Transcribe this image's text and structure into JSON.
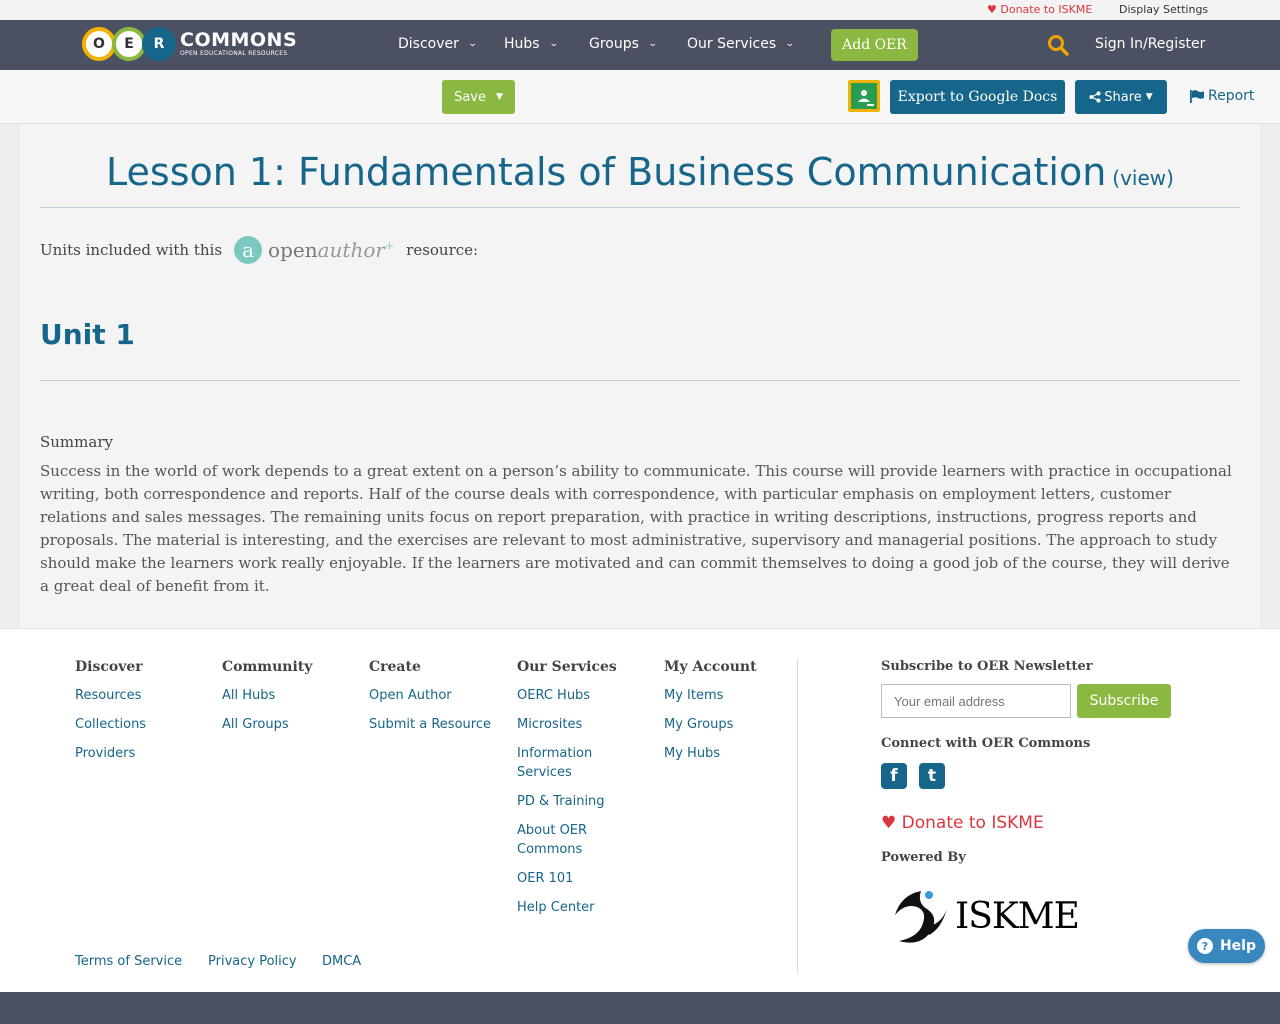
{
  "util": {
    "donate": "Donate to ISKME",
    "display_settings": "Display Settings"
  },
  "nav": {
    "logo_big": "COMMONS",
    "logo_small": "OPEN EDUCATIONAL RESOURCES",
    "logo_letters": [
      "O",
      "E",
      "R"
    ],
    "items": [
      {
        "label": "Discover"
      },
      {
        "label": "Hubs"
      },
      {
        "label": "Groups"
      },
      {
        "label": "Our Services"
      }
    ],
    "add_oer": "Add OER",
    "sign_in": "Sign In/Register"
  },
  "toolbar": {
    "save": "Save",
    "export": "Export to Google Docs",
    "share": "Share",
    "report": "Report"
  },
  "content": {
    "title": "Lesson 1: Fundamentals of Business Communication",
    "view_link": "(view)",
    "units_prefix": "Units included with this",
    "units_suffix": "resource:",
    "openauthor_a": "a",
    "openauthor_open": "open",
    "openauthor_author": "author",
    "openauthor_plus": "+",
    "unit_heading": "Unit 1",
    "summary_label": "Summary",
    "summary_text": "Success in the world of work depends to a great extent on a person’s ability to communicate. This course will provide learners with practice in occupational writing, both correspondence and reports. Half of the course deals with correspondence, with particular emphasis on employment letters, customer relations and sales messages. The remaining units focus on report preparation, with practice in writing descriptions, instructions, progress reports and proposals. The material is interesting, and the exercises are relevant to most administrative, supervisory and managerial positions. The approach to study should make the learners work really enjoyable. If the learners are motivated and can commit themselves to doing a good job of the course, they will derive a great deal of benefit from it."
  },
  "footer": {
    "discover": {
      "heading": "Discover",
      "links": [
        "Resources",
        "Collections",
        "Providers"
      ]
    },
    "community": {
      "heading": "Community",
      "links": [
        "All Hubs",
        "All Groups"
      ]
    },
    "create": {
      "heading": "Create",
      "links": [
        "Open Author",
        "Submit a Resource"
      ]
    },
    "services": {
      "heading": "Our Services",
      "links": [
        "OERC Hubs",
        "Microsites",
        "Information Services",
        "PD & Training",
        "About OER Commons",
        "OER 101",
        "Help Center"
      ]
    },
    "account": {
      "heading": "My Account",
      "links": [
        "My Items",
        "My Groups",
        "My Hubs"
      ]
    },
    "newsletter_heading": "Subscribe to OER Newsletter",
    "email_placeholder": "Your email address",
    "subscribe": "Subscribe",
    "connect_heading": "Connect with OER Commons",
    "facebook_glyph": "f",
    "twitter_glyph": "t",
    "donate": "Donate to ISKME",
    "powered_by": "Powered By",
    "iskme_logo_text": "ISKME",
    "legal": [
      "Terms of Service",
      "Privacy Policy",
      "DMCA"
    ]
  },
  "help_button": "Help",
  "colors": {
    "nav_bg": "#4b5162",
    "brand_blue": "#16658a",
    "brand_green": "#8bb840",
    "donate_red": "#d9373e",
    "search_yellow": "#f0a500"
  },
  "icons": {
    "search": "search-icon",
    "heart": "heart-icon",
    "chevron": "chevron-down-icon",
    "flag": "flag-icon",
    "share": "share-icon",
    "classroom": "google-classroom-icon",
    "facebook": "facebook-icon",
    "twitter": "twitter-icon"
  }
}
